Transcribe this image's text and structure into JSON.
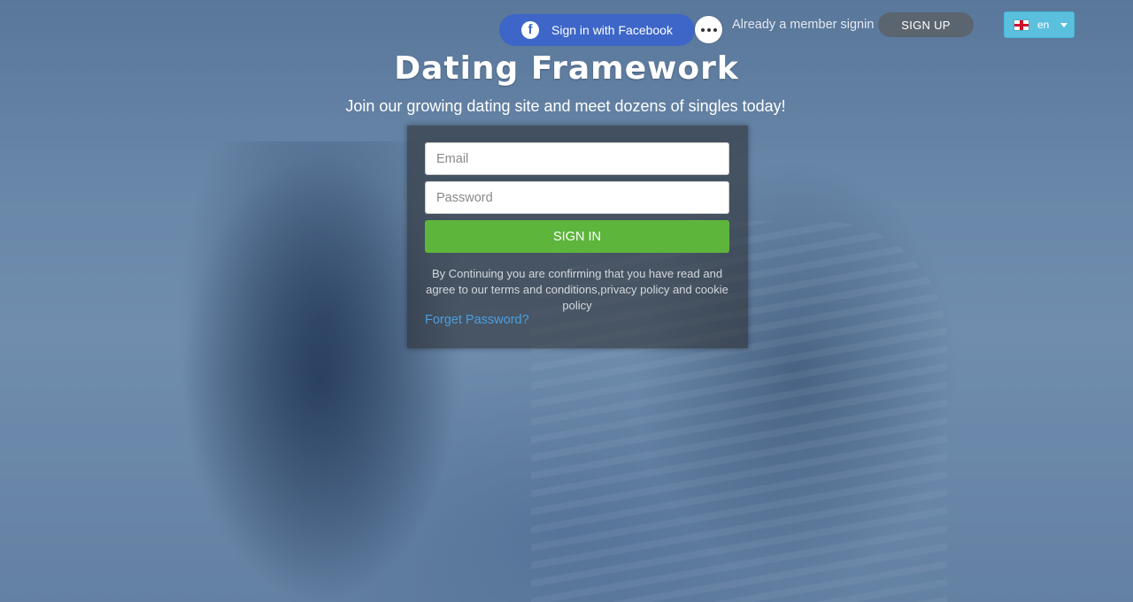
{
  "header": {
    "facebook_label": "Sign in with Facebook",
    "facebook_icon": "f",
    "more_icon": "more-dots-icon",
    "member_text": "Already a member signin",
    "signup_label": "SIGN UP",
    "language": "en"
  },
  "hero": {
    "title": "Dating Framework",
    "tagline": "Join our growing dating site and meet dozens of singles today!"
  },
  "login": {
    "email_placeholder": "Email",
    "password_placeholder": "Password",
    "signin_label": "SIGN IN",
    "terms_text": "By Continuing you are confirming that you have read and agree to our terms and conditions,privacy policy and cookie policy",
    "forget_label": "Forget Password?"
  },
  "colors": {
    "facebook_blue": "#3d66c8",
    "signin_green": "#5db53c",
    "language_button": "#5bc0de",
    "link_blue": "#4a9fe0"
  }
}
